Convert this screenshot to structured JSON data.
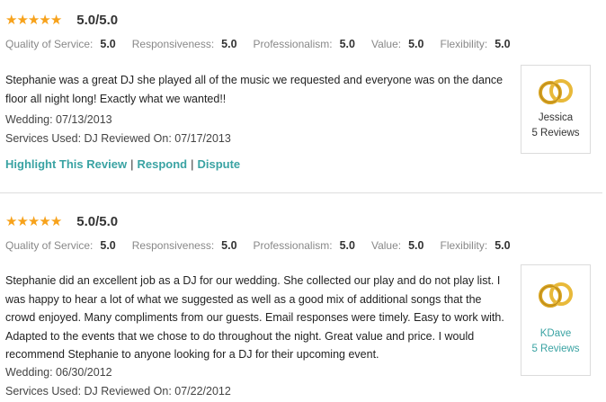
{
  "reviews": [
    {
      "stars": 5,
      "score": "5.0/5.0",
      "ratings": [
        {
          "label": "Quality of Service:",
          "value": "5.0"
        },
        {
          "label": "Responsiveness:",
          "value": "5.0"
        },
        {
          "label": "Professionalism:",
          "value": "5.0"
        },
        {
          "label": "Value:",
          "value": "5.0"
        },
        {
          "label": "Flexibility:",
          "value": "5.0"
        }
      ],
      "text": "Stephanie was a great DJ she played all of the music we requested and everyone was on the dance floor all night long! Exactly what we wanted!!",
      "wedding": "Wedding: 07/13/2013",
      "services": "Services Used: DJ Reviewed On: 07/17/2013",
      "actions": [
        "Highlight This Review",
        "Respond",
        "Dispute"
      ],
      "reviewer": {
        "name": "Jessica",
        "count": "5 Reviews"
      }
    },
    {
      "stars": 5,
      "score": "5.0/5.0",
      "ratings": [
        {
          "label": "Quality of Service:",
          "value": "5.0"
        },
        {
          "label": "Responsiveness:",
          "value": "5.0"
        },
        {
          "label": "Professionalism:",
          "value": "5.0"
        },
        {
          "label": "Value:",
          "value": "5.0"
        },
        {
          "label": "Flexibility:",
          "value": "5.0"
        }
      ],
      "text": "Stephanie did an excellent job as a DJ for our wedding. She collected our play and do not play list. I was happy to hear a lot of what we suggested as well as a good mix of additional songs that the crowd enjoyed. Many compliments from our guests. Email responses were timely. Easy to work with. Adapted to the events that we chose to do throughout the night. Great value and price. I would recommend Stephanie to anyone looking for a DJ for their upcoming event.",
      "wedding": "Wedding: 06/30/2012",
      "services": "Services Used: DJ Reviewed On: 07/22/2012",
      "reviewer": {
        "name": "KDave",
        "count": "5 Reviews"
      }
    }
  ],
  "colors": {
    "star": "#f7a21b",
    "link": "#3aa3a3",
    "ring": "#d9a521"
  },
  "icons": {
    "star": "star-icon",
    "reviewer": "wedding-rings-icon"
  }
}
